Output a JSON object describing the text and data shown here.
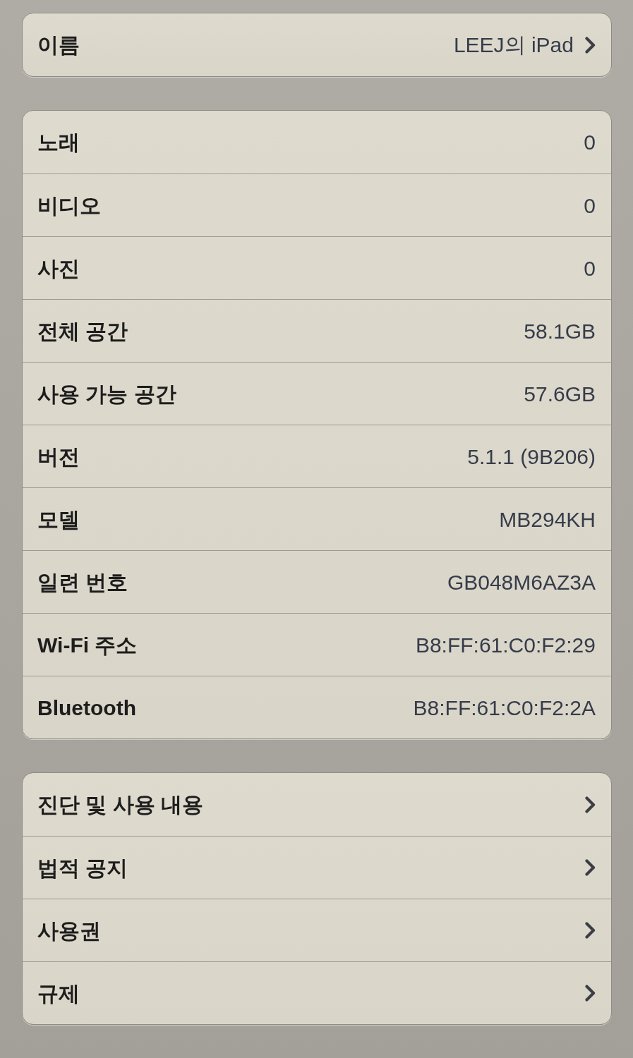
{
  "groups": [
    {
      "rows": [
        {
          "kind": "link",
          "label": "이름",
          "value": "LEEJ의 iPad"
        }
      ]
    },
    {
      "rows": [
        {
          "kind": "info",
          "label": "노래",
          "value": "0"
        },
        {
          "kind": "info",
          "label": "비디오",
          "value": "0"
        },
        {
          "kind": "info",
          "label": "사진",
          "value": "0"
        },
        {
          "kind": "info",
          "label": "전체 공간",
          "value": "58.1GB"
        },
        {
          "kind": "info",
          "label": "사용 가능 공간",
          "value": "57.6GB"
        },
        {
          "kind": "info",
          "label": "버전",
          "value": "5.1.1 (9B206)"
        },
        {
          "kind": "info",
          "label": "모델",
          "value": "MB294KH"
        },
        {
          "kind": "info",
          "label": "일련 번호",
          "value": "GB048M6AZ3A"
        },
        {
          "kind": "info",
          "label": "Wi-Fi 주소",
          "value": "B8:FF:61:C0:F2:29"
        },
        {
          "kind": "info",
          "label": "Bluetooth",
          "value": "B8:FF:61:C0:F2:2A"
        }
      ]
    },
    {
      "rows": [
        {
          "kind": "link",
          "label": "진단 및 사용 내용"
        },
        {
          "kind": "link",
          "label": "법적 공지"
        },
        {
          "kind": "link",
          "label": "사용권"
        },
        {
          "kind": "link",
          "label": "규제"
        }
      ]
    }
  ]
}
